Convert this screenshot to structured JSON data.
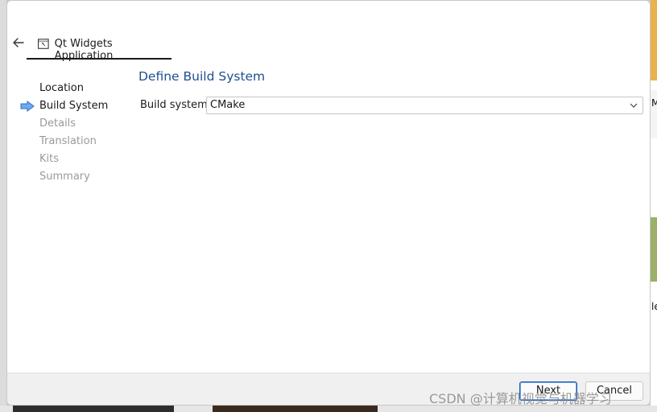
{
  "wizard": {
    "tab_title": "Qt Widgets Application",
    "steps": [
      {
        "label": "Location",
        "state": "done"
      },
      {
        "label": "Build System",
        "state": "current"
      },
      {
        "label": "Details",
        "state": "pending"
      },
      {
        "label": "Translation",
        "state": "pending"
      },
      {
        "label": "Kits",
        "state": "pending"
      },
      {
        "label": "Summary",
        "state": "pending"
      }
    ],
    "page_title": "Define Build System",
    "build_system": {
      "label": "Build system:",
      "value": "CMake"
    },
    "buttons": {
      "next": "Next",
      "cancel": "Cancel"
    }
  },
  "background": {
    "right_glyph_1": "M",
    "right_glyph_2": "le"
  },
  "watermark": "CSDN @计算机视觉与机器学习",
  "colors": {
    "accent": "#1f4f8f",
    "current_step_arrow": "#4a90e2",
    "footer_bg": "#f0f0f0"
  },
  "icons": {
    "back": "arrow-left-icon",
    "app": "qt-app-icon",
    "current_step": "arrow-right-icon",
    "dropdown": "chevron-down-icon"
  }
}
